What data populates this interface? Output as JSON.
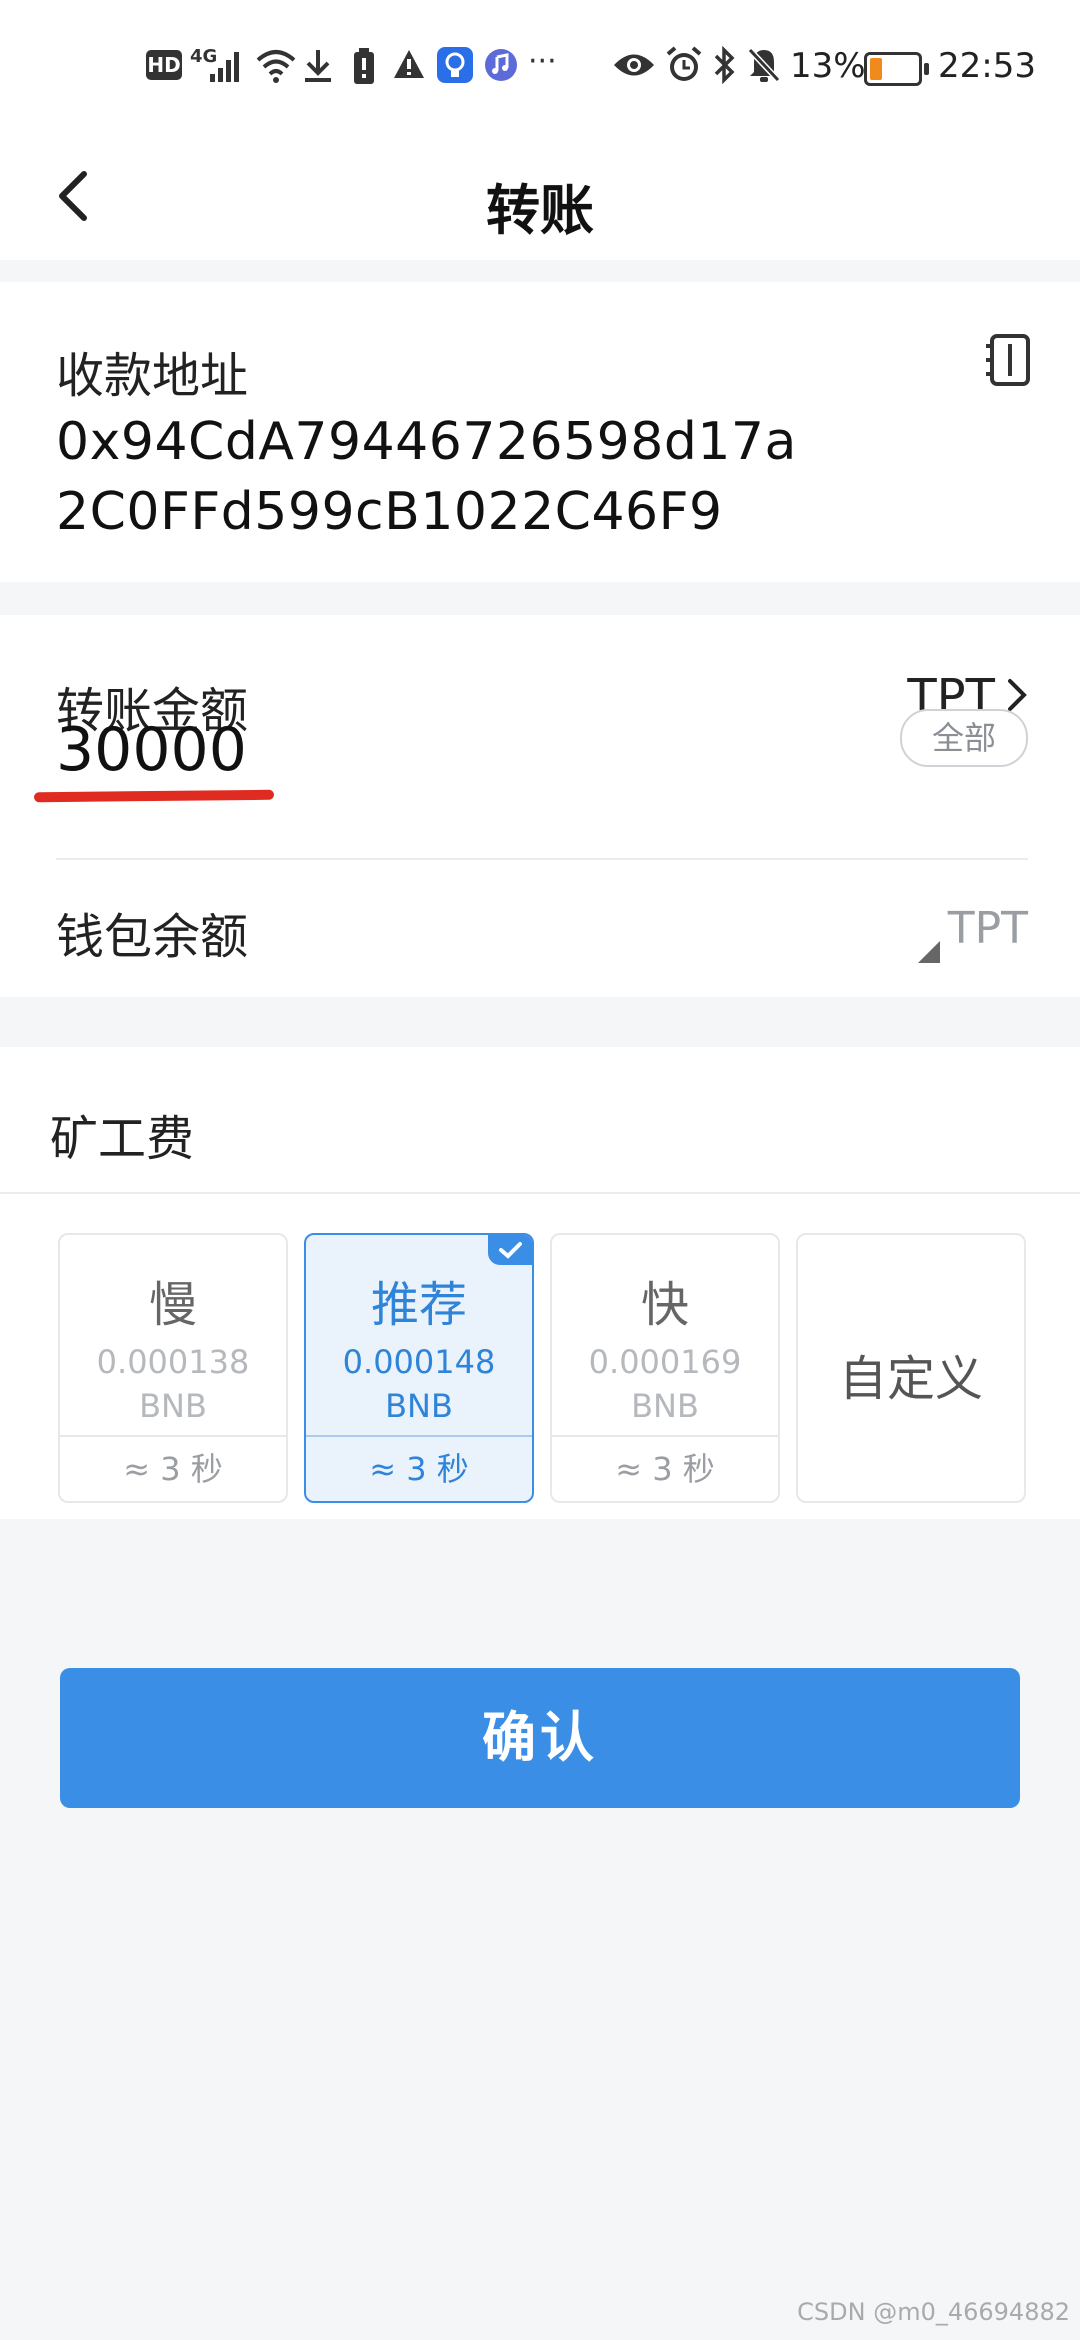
{
  "status_bar": {
    "network_badge": "HD",
    "network_type": "4G",
    "battery_percent": "13%",
    "time": "22:53",
    "more": "···"
  },
  "nav": {
    "title": "转账"
  },
  "recipient": {
    "label": "收款地址",
    "address_line1": "0x94CdA79446726598d17a",
    "address_line2": "2C0FFd599cB1022C46F9"
  },
  "transfer": {
    "label": "转账金额",
    "token": "TPT",
    "amount": "30000",
    "all_label": "全部",
    "balance_label": "钱包余额",
    "balance_token": "TPT"
  },
  "fee": {
    "label": "矿工费",
    "options": [
      {
        "speed": "慢",
        "amount": "0.000138",
        "unit": "BNB",
        "time": "≈ 3 秒"
      },
      {
        "speed": "推荐",
        "amount": "0.000148",
        "unit": "BNB",
        "time": "≈ 3 秒"
      },
      {
        "speed": "快",
        "amount": "0.000169",
        "unit": "BNB",
        "time": "≈ 3 秒"
      }
    ],
    "custom_label": "自定义",
    "selected_index": 1
  },
  "confirm_label": "确认",
  "watermark": "CSDN @m0_46694882",
  "colors": {
    "accent": "#3a8ee6",
    "underline": "#e02b20",
    "battery_low": "#f08a1c"
  }
}
